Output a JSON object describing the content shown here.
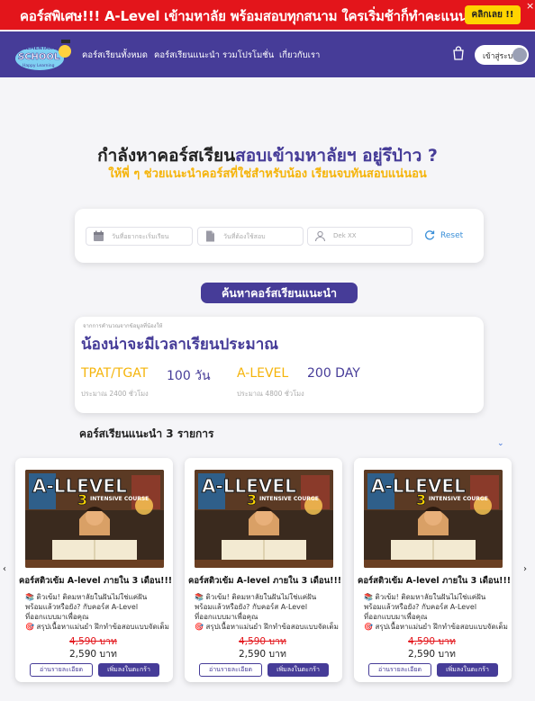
{
  "promo": {
    "text": "คอร์สพิเศษ!!! A-Level เข้ามหาลัย พร้อมสอบทุกสนาม ใครเริ่มช้าก็ทำคะแนนปังได้",
    "cta": "คลิกเลย !!",
    "close": "×"
  },
  "nav": {
    "logo_line1": "ELEMENTARY",
    "logo_line2": "SCHOOL",
    "logo_line3": "Happy Learning",
    "items": [
      "คอร์สเรียนทั้งหมด",
      "คอร์สเรียนแนะนำ",
      "รวมโปรโมชั่น",
      "เกี่ยวกับเรา"
    ],
    "login": "เข้าสู่ระบบ"
  },
  "hero": {
    "headline_part1": "กำลังหาคอร์สเรียน",
    "headline_part2": "สอบเข้ามหาลัยฯ อยู่รึป่าว ?",
    "subhead": "ให้พี่ ๆ ช่วยแนะนำคอร์สที่ใช่สำหรับน้อง เรียนจบทันสอบแน่นอน"
  },
  "filter": {
    "start_date_placeholder": "วันที่อยากจะเริ่มเรียน",
    "exam_date_placeholder": "วันที่ต้องใช้สอบ",
    "grade_placeholder": "Dek XX",
    "reset": "Reset"
  },
  "recommend_button": "ค้นหาคอร์สเรียนแนะนำ",
  "estimate": {
    "note": "จากการคำนวณจากข้อมูลที่น้องให้",
    "title": "น้องน่าจะมีเวลาเรียนประมาณ",
    "items": [
      {
        "label": "TPAT/TGAT",
        "value": "100 วัน",
        "sub": "ประมาณ 2400 ชั่วโมง"
      },
      {
        "label": "A-LEVEL",
        "value": "200 DAY",
        "sub": "ประมาณ 4800 ชั่วโมง"
      }
    ]
  },
  "courses_section": {
    "title": "คอร์สเรียนแนะนำ 3 รายการ",
    "chevron": "⌄",
    "prev": "‹",
    "next": "›"
  },
  "courses": [
    {
      "thumb_title": "A-LLEVEL",
      "thumb_badge": "3",
      "thumb_sub": "INTENSIVE COURSE",
      "title": "คอร์สติวเข้ม A-level ภายใน 3 เดือน!!!",
      "desc1": "📚 ติวเข้ม! ติดมหาลัยในฝันไม่ใช่แค่ฝัน",
      "desc2": "พร้อมแล้วหรือยัง? กับคอร์ส A-Level",
      "desc3": "ที่ออกแบบมาเพื่อคุณ",
      "desc4": "🎯 สรุปเนื้อหาแม่นยำ ฝึกทำข้อสอบแบบจัดเต็ม",
      "old_price": "4,590 บาท",
      "price": "2,590 บาท",
      "detail_btn": "อ่านรายละเอียด",
      "cart_btn": "เพิ่มลงในตะกร้า"
    },
    {
      "thumb_title": "A-LLEVEL",
      "thumb_badge": "3",
      "thumb_sub": "INTENSIVE COURGE",
      "title": "คอร์สติวเข้ม A-level ภายใน 3 เดือน!!!",
      "desc1": "📚 ติวเข้ม! ติดมหาลัยในฝันไม่ใช่แค่ฝัน",
      "desc2": "พร้อมแล้วหรือยัง? กับคอร์ส A-Level",
      "desc3": "ที่ออกแบบมาเพื่อคุณ",
      "desc4": "🎯 สรุปเนื้อหาแม่นยำ ฝึกทำข้อสอบแบบจัดเต็ม",
      "old_price": "4,590 บาท",
      "price": "2,590 บาท",
      "detail_btn": "อ่านรายละเอียด",
      "cart_btn": "เพิ่มลงในตะกร้า"
    },
    {
      "thumb_title": "A-LLEVEL",
      "thumb_badge": "3",
      "thumb_sub": "INTENSIVE COURGE",
      "title": "คอร์สติวเข้ม A-level ภายใน 3 เดือน!!!",
      "desc1": "📚 ติวเข้ม! ติดมหาลัยในฝันไม่ใช่แค่ฝัน",
      "desc2": "พร้อมแล้วหรือยัง? กับคอร์ส A-Level",
      "desc3": "ที่ออกแบบมาเพื่อคุณ",
      "desc4": "🎯 สรุปเนื้อหาแม่นยำ ฝึกทำข้อสอบแบบจัดเต็ม",
      "old_price": "4,590 บาท",
      "price": "2,590 บาท",
      "detail_btn": "อ่านรายละเอียด",
      "cart_btn": "เพิ่มลงในตะกร้า"
    }
  ],
  "colors": {
    "brand": "#463c98",
    "promo_red": "#e3151b",
    "accent_yellow": "#f5b40a",
    "link_blue": "#3a8fd8"
  }
}
